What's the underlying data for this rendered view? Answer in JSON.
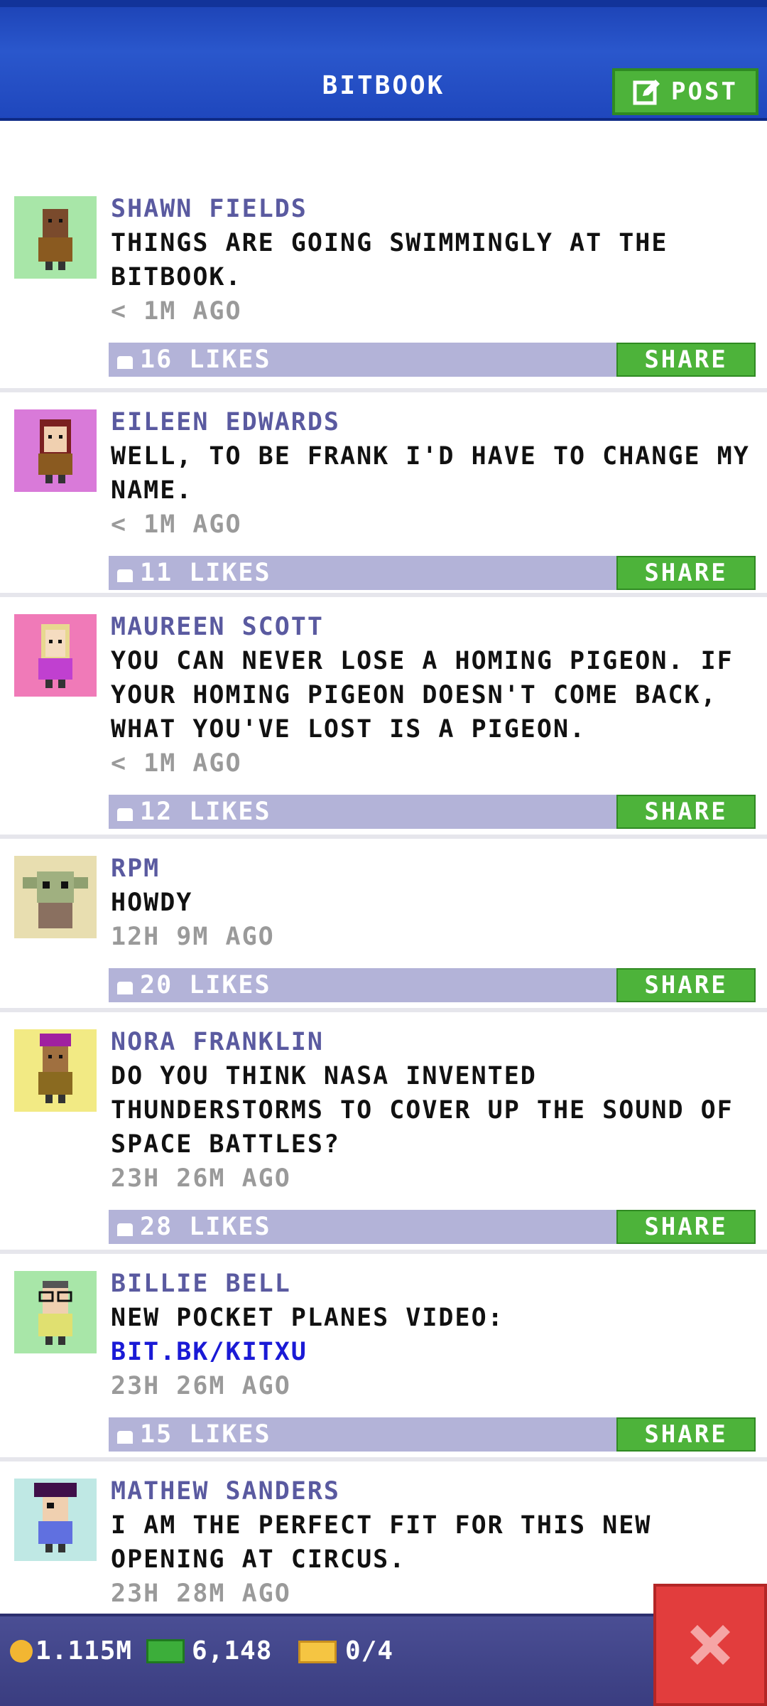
{
  "header": {
    "title": "BITBOOK",
    "post_label": "POST"
  },
  "posts": [
    {
      "name": "SHAWN FIELDS",
      "text": "THINGS ARE GOING SWIMMINGLY AT THE BITBOOK.",
      "time": "< 1M AGO",
      "likes": "16 LIKES",
      "share": "SHARE",
      "avatar_bg": "#a8e6a8"
    },
    {
      "name": "EILEEN EDWARDS",
      "text": "WELL, TO BE FRANK I'D HAVE TO CHANGE MY NAME.",
      "time": "< 1M AGO",
      "likes": "11 LIKES",
      "share": "SHARE",
      "avatar_bg": "#d97ad9"
    },
    {
      "name": "MAUREEN SCOTT",
      "text": "YOU CAN NEVER LOSE A HOMING PIGEON. IF YOUR HOMING PIGEON DOESN'T COME BACK, WHAT YOU'VE LOST IS A PIGEON.",
      "time": "< 1M AGO",
      "likes": "12 LIKES",
      "share": "SHARE",
      "avatar_bg": "#f07ab8"
    },
    {
      "name": "RPM",
      "text": "HOWDY",
      "time": "12H 9M AGO",
      "likes": "20 LIKES",
      "share": "SHARE",
      "avatar_bg": "#e8deb0"
    },
    {
      "name": "NORA FRANKLIN",
      "text": "DO YOU THINK NASA INVENTED THUNDERSTORMS TO COVER UP THE SOUND OF SPACE BATTLES?",
      "time": "23H 26M AGO",
      "likes": "28 LIKES",
      "share": "SHARE",
      "avatar_bg": "#f2ea84"
    },
    {
      "name": "BILLIE BELL",
      "text": "NEW POCKET PLANES VIDEO:",
      "link": "BIT.BK/KITXU",
      "time": "23H 26M AGO",
      "likes": "15 LIKES",
      "share": "SHARE",
      "avatar_bg": "#a8e6a8"
    },
    {
      "name": "MATHEW SANDERS",
      "text": "I AM THE PERFECT FIT FOR THIS NEW OPENING AT CIRCUS.",
      "time": "23H 28M AGO",
      "avatar_bg": "#bfe8e4"
    }
  ],
  "footer": {
    "coins": "1.115M",
    "bux": "6,148",
    "tickets": "0/4"
  },
  "colors": {
    "accent_blue": "#2a57cc",
    "share_green": "#4db33a",
    "like_bar": "#b3b3d8",
    "name_purple": "#5a5aa0",
    "close_red": "#e23d3d"
  }
}
